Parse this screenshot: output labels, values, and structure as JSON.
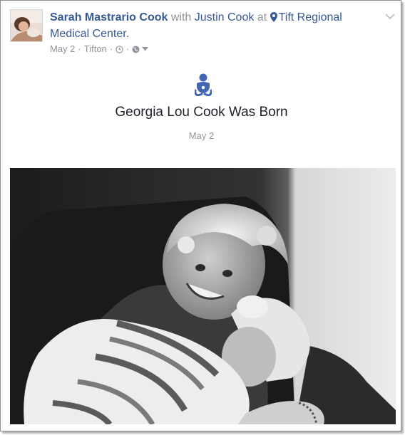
{
  "post": {
    "author": "Sarah Mastrario Cook",
    "with_text": "with",
    "tagged_person": "Justin Cook",
    "at_text": "at",
    "location": "Tift Regional Medical Center.",
    "date": "May 2",
    "separator": "·",
    "place": "Tifton"
  },
  "life_event": {
    "icon": "baby-icon",
    "title": "Georgia Lou Cook Was Born",
    "date": "May 2"
  },
  "icons": {
    "menu": "chevron-down-icon",
    "location": "map-pin-icon",
    "time": "clock-icon",
    "privacy": "globe-icon",
    "audience_menu": "caret-down-icon"
  },
  "colors": {
    "link": "#365899",
    "meta": "#90949c",
    "event_icon": "#4267b2"
  }
}
